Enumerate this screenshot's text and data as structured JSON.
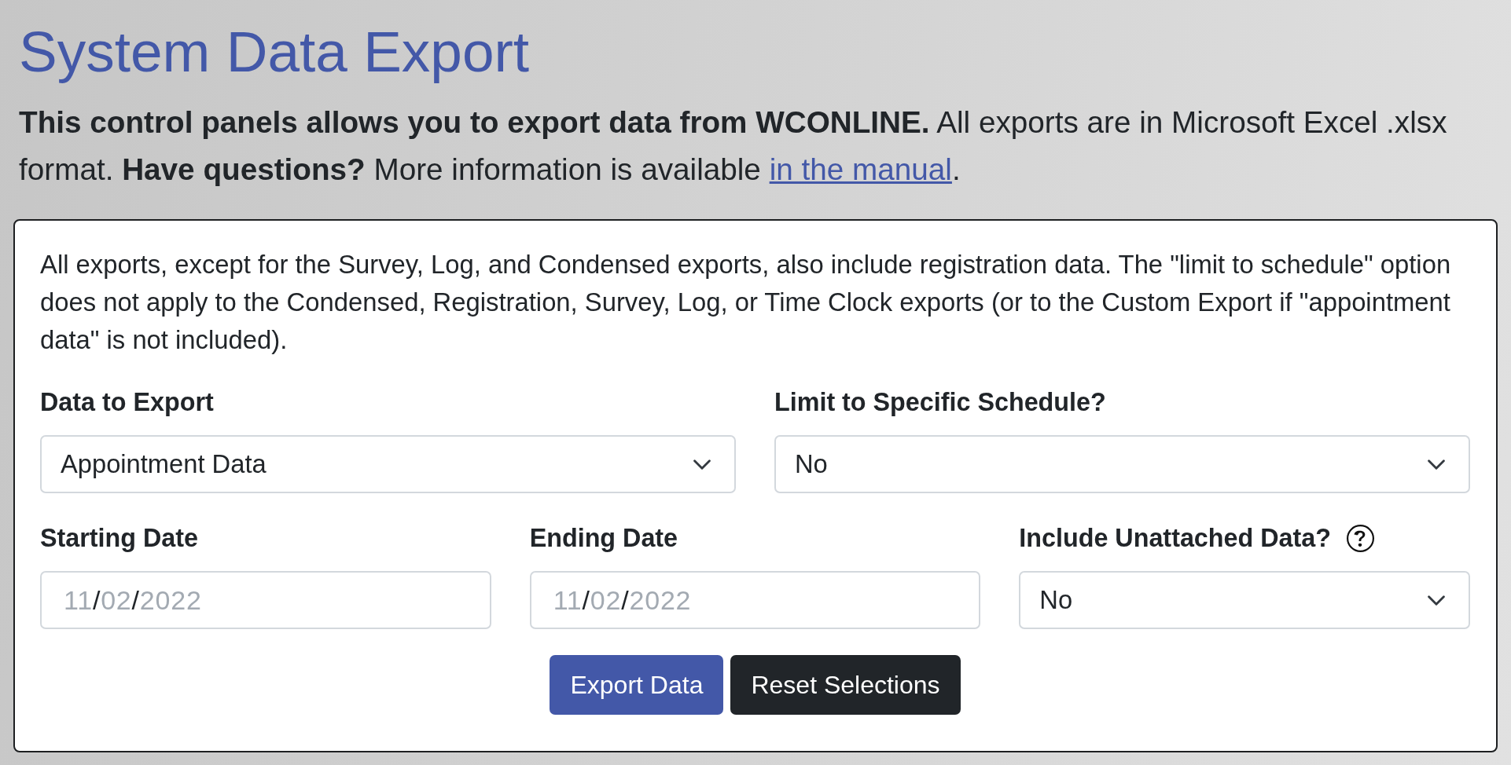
{
  "title": "System Data Export",
  "intro": {
    "text": "**This control panels allows you to export data from WCONLINE.** All exports are in Microsoft Excel .xlsx format. **Have questions?** More information is available ",
    "link": "in the manual",
    "after_link": "."
  },
  "panel": {
    "note": "All exports, except for the Survey, Log, and Condensed exports, also include registration data. The \"limit to schedule\" option does not apply to the Condensed, Registration, Survey, Log, or Time Clock exports (or to the Custom Export if \"appointment data\" is not included).",
    "rows": [
      {
        "fields": [
          {
            "kind": "select",
            "label": "Data to Export",
            "value": "Appointment Data",
            "help": false
          },
          {
            "kind": "select",
            "label": "Limit to Specific Schedule?",
            "value": "No",
            "help": false
          }
        ]
      },
      {
        "fields": [
          {
            "kind": "date",
            "label": "Starting Date",
            "placeholder": [
              {
                "kind": "number",
                "text": "11"
              },
              {
                "kind": "separator",
                "text": "/"
              },
              {
                "kind": "number",
                "text": "02"
              },
              {
                "kind": "separator",
                "text": "/"
              },
              {
                "kind": "number",
                "text": "2022"
              }
            ],
            "help": false
          },
          {
            "kind": "date",
            "label": "Ending Date",
            "placeholder": [
              {
                "kind": "number",
                "text": "11"
              },
              {
                "kind": "separator",
                "text": "/"
              },
              {
                "kind": "number",
                "text": "02"
              },
              {
                "kind": "separator",
                "text": "/"
              },
              {
                "kind": "number",
                "text": "2022"
              }
            ],
            "help": false
          },
          {
            "kind": "select",
            "label": "Include Unattached Data?",
            "value": "No",
            "help": true
          }
        ]
      }
    ],
    "buttons": [
      {
        "kind": "primary",
        "label": "Export Data"
      },
      {
        "kind": "dark",
        "label": "Reset Selections"
      }
    ]
  }
}
